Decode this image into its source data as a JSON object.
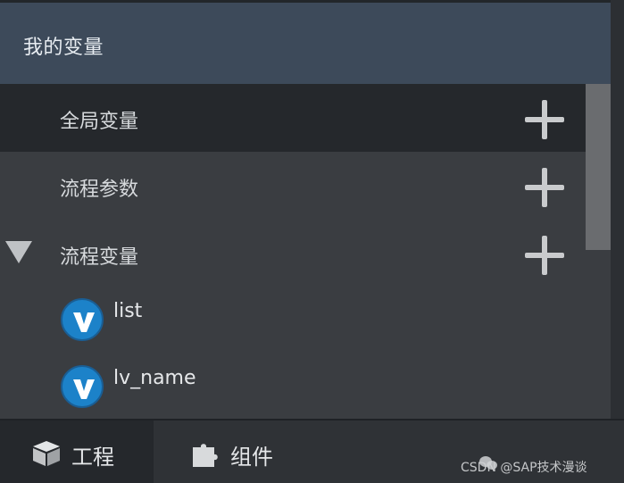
{
  "header": {
    "title": "我的变量"
  },
  "tree": {
    "sections": [
      {
        "label": "全局变量",
        "selected": true,
        "icon": "plus-icon"
      },
      {
        "label": "流程参数",
        "selected": false,
        "icon": "plus-icon"
      },
      {
        "label": "流程变量",
        "selected": false,
        "expanded": true,
        "icon": "plus-icon"
      }
    ],
    "variables": [
      {
        "label": "list",
        "icon": "variable-v-icon"
      },
      {
        "label": "lv_name",
        "icon": "variable-v-icon"
      }
    ]
  },
  "tabs": [
    {
      "label": "工程",
      "icon": "cube-icon",
      "active": true
    },
    {
      "label": "组件",
      "icon": "puzzle-icon",
      "active": false
    }
  ],
  "watermark": "CSDN @SAP技术漫谈",
  "colors": {
    "header_bg": "#3d4a5a",
    "panel_bg": "#3a3d41",
    "selected_bg": "#25282c",
    "variable_badge": "#1c82c9",
    "text": "#d7dadd"
  }
}
